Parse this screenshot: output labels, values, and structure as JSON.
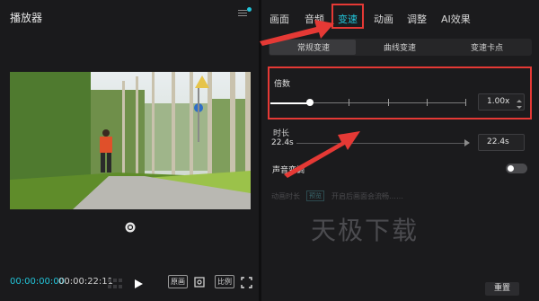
{
  "player": {
    "title": "播放器",
    "time_current": "00:00:00:00",
    "time_total": "00:00:22:11",
    "btn_fill": "原画",
    "btn_ratio": "比例"
  },
  "tabs": [
    "画面",
    "音频",
    "变速",
    "动画",
    "调整",
    "AI效果"
  ],
  "speed": {
    "subtabs": [
      "常规变速",
      "曲线变速",
      "变速卡点"
    ],
    "multiplier_label": "倍数",
    "multiplier_value": "1.00x",
    "multiplier_fraction": 0.2,
    "duration_label": "时长",
    "duration_from": "22.4s",
    "duration_to": "22.4s",
    "pitch_label": "声音变调",
    "pitch_enabled": false,
    "faded_row_left": "动画时长",
    "faded_badge": "预览",
    "faded_row_right": "开启后画面会流畅……"
  },
  "watermark": "天极下载",
  "reset_label": "重置",
  "colors": {
    "accent": "#22c4d9",
    "annotation": "#e53935"
  },
  "icons": [
    "menu-icon",
    "refresh-icon",
    "grid-icon",
    "play-icon",
    "crop-icon",
    "fullscreen-icon",
    "spin-icon"
  ]
}
